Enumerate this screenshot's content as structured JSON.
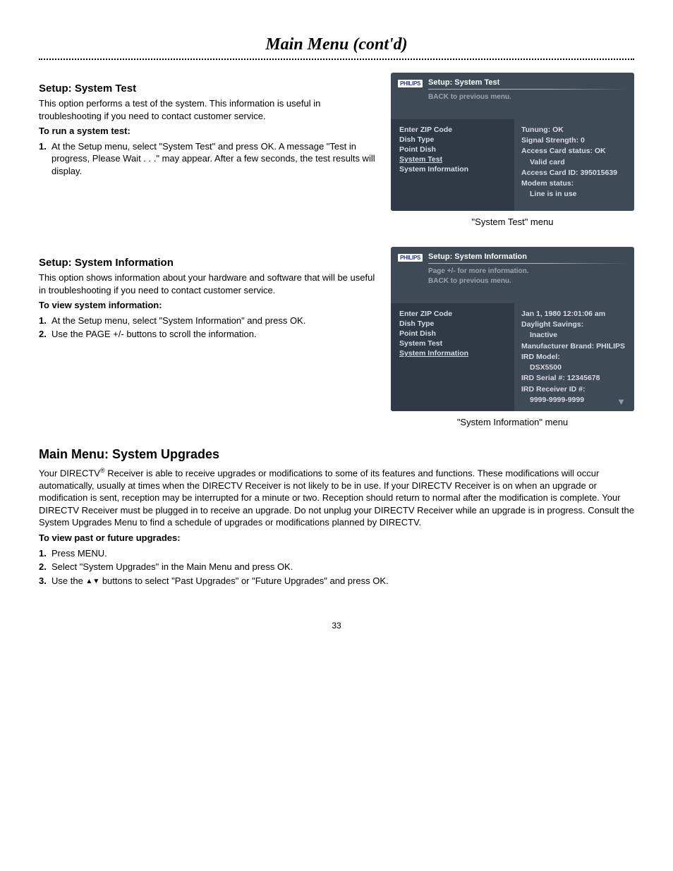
{
  "page": {
    "title": "Main Menu (cont'd)",
    "number": "33"
  },
  "section1": {
    "heading": "Setup: System Test",
    "intro": "This option performs a test of the system. This information is useful in troubleshooting if you need to contact customer service.",
    "runHead": "To run a system test:",
    "step1num": "1.",
    "step1": "At the Setup menu, select \"System Test\" and press OK. A message \"Test in progress, Please Wait . . .\" may appear. After a few seconds, the test results will display.",
    "caption": "\"System Test\" menu",
    "screen": {
      "logo": "PHILIPS",
      "title": "Setup: System Test",
      "sub": "BACK to previous menu.",
      "menu": {
        "i0": "Enter ZIP Code",
        "i1": "Dish Type",
        "i2": "Point Dish",
        "i3": "System Test",
        "i4": "System Information"
      },
      "content": {
        "l0": "Tunung: OK",
        "l1": "Signal Strength: 0",
        "l2": "Access Card status: OK",
        "l3": "Valid card",
        "l4": "Access Card ID: 395015639",
        "l5": "Modem status:",
        "l6": "Line is in use"
      }
    }
  },
  "section2": {
    "heading": "Setup: System Information",
    "intro": "This option shows information about your hardware and software that will be useful in troubleshooting if you need to contact customer service.",
    "viewHead": "To view system information:",
    "step1num": "1.",
    "step1": "At the Setup menu, select \"System Information\" and press OK.",
    "step2num": "2.",
    "step2": "Use the PAGE +/- buttons to scroll the information.",
    "caption": "\"System Information\" menu",
    "screen": {
      "logo": "PHILIPS",
      "title": "Setup: System Information",
      "sub1": "Page +/- for more information.",
      "sub2": "BACK to previous menu.",
      "menu": {
        "i0": "Enter ZIP Code",
        "i1": "Dish Type",
        "i2": "Point Dish",
        "i3": "System Test",
        "i4": "System Information"
      },
      "content": {
        "l0": "Jan 1, 1980 12:01:06 am",
        "l1": "Daylight Savings:",
        "l2": "Inactive",
        "l3": "Manufacturer Brand: PHILIPS",
        "l4": "IRD Model:",
        "l5": "DSX5500",
        "l6": "IRD Serial #: 12345678",
        "l7": "IRD Receiver ID #:",
        "l8": "9999-9999-9999"
      }
    }
  },
  "section3": {
    "heading": "Main Menu: System Upgrades",
    "para_a": "Your DIRECTV",
    "para_b": " Receiver is able to receive upgrades or modifications to some of its features and functions. These modifications will occur automatically, usually at times when the DIRECTV Receiver is not likely to be in use. If your DIRECTV Receiver is on when an upgrade or modification is sent, reception may be interrupted for a minute or two. Reception should return to normal after the modification is complete. Your DIRECTV Receiver must be plugged in to receive an upgrade. Do not unplug your DIRECTV Receiver while an upgrade is in progress. Consult the System Upgrades Menu to find a schedule of upgrades or modifications planned by DIRECTV.",
    "viewHead": "To view past or future upgrades:",
    "step1num": "1.",
    "step1": "Press MENU.",
    "step2num": "2.",
    "step2": "Select \"System Upgrades\" in the Main Menu and press OK.",
    "step3num": "3.",
    "step3a": "Use the ",
    "step3b": " buttons to select \"Past Upgrades\" or \"Future Upgrades\" and press OK."
  }
}
